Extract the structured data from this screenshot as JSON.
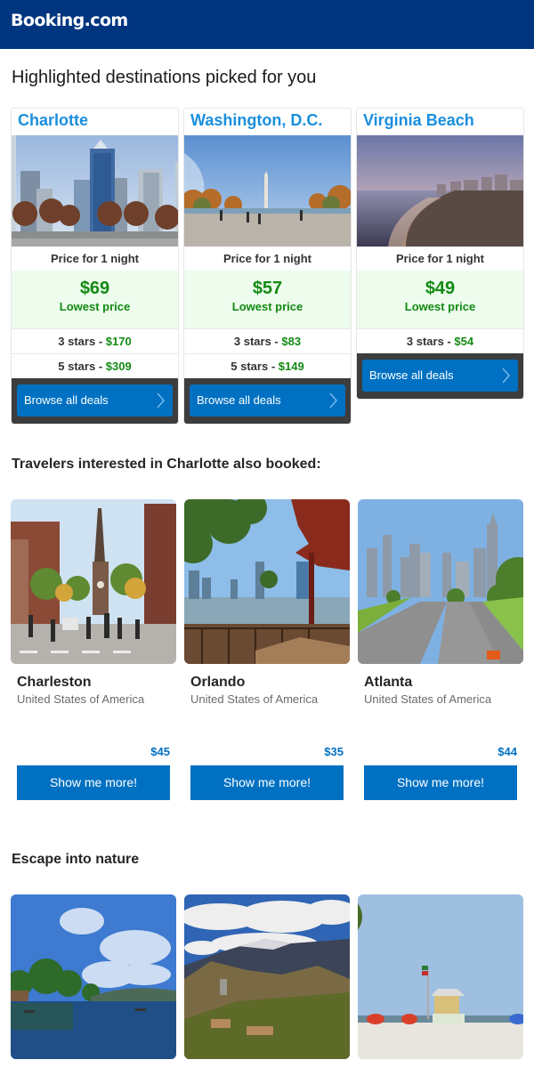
{
  "header": {
    "logo": "Booking.com"
  },
  "highlighted": {
    "title": "Highlighted destinations picked for you",
    "price_label": "Price for 1 night",
    "lowest_label": "Lowest price",
    "browse_label": "Browse all deals",
    "cards": [
      {
        "name": "Charlotte",
        "image": "charlotte-skyline-photo",
        "lowest": "$69",
        "rows": [
          {
            "label": "3 stars -",
            "value": "$170"
          },
          {
            "label": "5 stars -",
            "value": "$309"
          }
        ]
      },
      {
        "name": "Washington, D.C.",
        "image": "washington-monument-photo",
        "lowest": "$57",
        "rows": [
          {
            "label": "3 stars -",
            "value": "$83"
          },
          {
            "label": "5 stars -",
            "value": "$149"
          }
        ]
      },
      {
        "name": "Virginia Beach",
        "image": "virginia-beach-sunset-photo",
        "lowest": "$49",
        "rows": [
          {
            "label": "3 stars -",
            "value": "$54"
          }
        ]
      }
    ]
  },
  "also_booked": {
    "title": "Travelers interested in Charlotte also booked:",
    "button_label": "Show me more!",
    "items": [
      {
        "name": "Charleston",
        "country": "United States of America",
        "price": "$45",
        "image": "charleston-street-photo"
      },
      {
        "name": "Orlando",
        "country": "United States of America",
        "price": "$35",
        "image": "orlando-lake-photo"
      },
      {
        "name": "Atlanta",
        "country": "United States of America",
        "price": "$44",
        "image": "atlanta-highway-photo"
      }
    ]
  },
  "nature": {
    "title": "Escape into nature",
    "items": [
      {
        "image": "lake-photo"
      },
      {
        "image": "mountains-photo"
      },
      {
        "image": "beach-lifeguard-photo"
      }
    ]
  },
  "colors": {
    "header_bg": "#003580",
    "city_name": "#1a8fde",
    "price_green": "#138a13",
    "lowest_bg": "#edfced",
    "button_blue": "#0071c2",
    "card_footer": "#3d3d3d"
  }
}
